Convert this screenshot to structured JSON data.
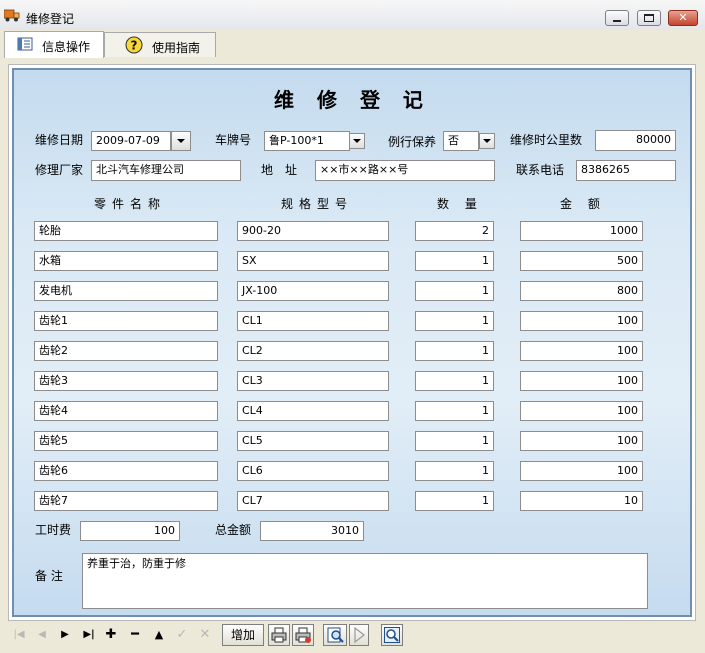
{
  "window": {
    "title": "维修登记"
  },
  "tabs": [
    {
      "label": "信息操作"
    },
    {
      "label": "使用指南"
    }
  ],
  "form": {
    "title": "维 修 登 记",
    "repair_date_label": "维修日期",
    "repair_date_value": "2009-07-09",
    "plate_label": "车牌号",
    "plate_value": "鲁P-100*1",
    "routine_label": "例行保养",
    "routine_value": "否",
    "mileage_label": "维修时公里数",
    "mileage_value": "80000",
    "factory_label": "修理厂家",
    "factory_value": "北斗汽车修理公司",
    "address_label": "地　址",
    "address_value": "××市××路××号",
    "phone_label": "联系电话",
    "phone_value": "8386265",
    "col_part_name": "零件名称",
    "col_spec": "规格型号",
    "col_qty": "数 量",
    "col_amount": "金 额",
    "parts": [
      {
        "name": "轮胎",
        "spec": "900-20",
        "qty": "2",
        "amount": "1000"
      },
      {
        "name": "水箱",
        "spec": "SX",
        "qty": "1",
        "amount": "500"
      },
      {
        "name": "发电机",
        "spec": "JX-100",
        "qty": "1",
        "amount": "800"
      },
      {
        "name": "齿轮1",
        "spec": "CL1",
        "qty": "1",
        "amount": "100"
      },
      {
        "name": "齿轮2",
        "spec": "CL2",
        "qty": "1",
        "amount": "100"
      },
      {
        "name": "齿轮3",
        "spec": "CL3",
        "qty": "1",
        "amount": "100"
      },
      {
        "name": "齿轮4",
        "spec": "CL4",
        "qty": "1",
        "amount": "100"
      },
      {
        "name": "齿轮5",
        "spec": "CL5",
        "qty": "1",
        "amount": "100"
      },
      {
        "name": "齿轮6",
        "spec": "CL6",
        "qty": "1",
        "amount": "100"
      },
      {
        "name": "齿轮7",
        "spec": "CL7",
        "qty": "1",
        "amount": "10"
      }
    ],
    "labor_label": "工时费",
    "labor_value": "100",
    "total_label": "总金额",
    "total_value": "3010",
    "notes_label": "备 注",
    "notes_value": "养重于治，防重于修"
  },
  "toolbar": {
    "first": "|◀",
    "prev": "◀",
    "next": "▶",
    "last": "▶|",
    "add_icon": "✚",
    "delete_icon": "━",
    "up_icon": "▲",
    "save_icon": "✓",
    "cancel_icon": "✕",
    "add_button": "增加"
  }
}
